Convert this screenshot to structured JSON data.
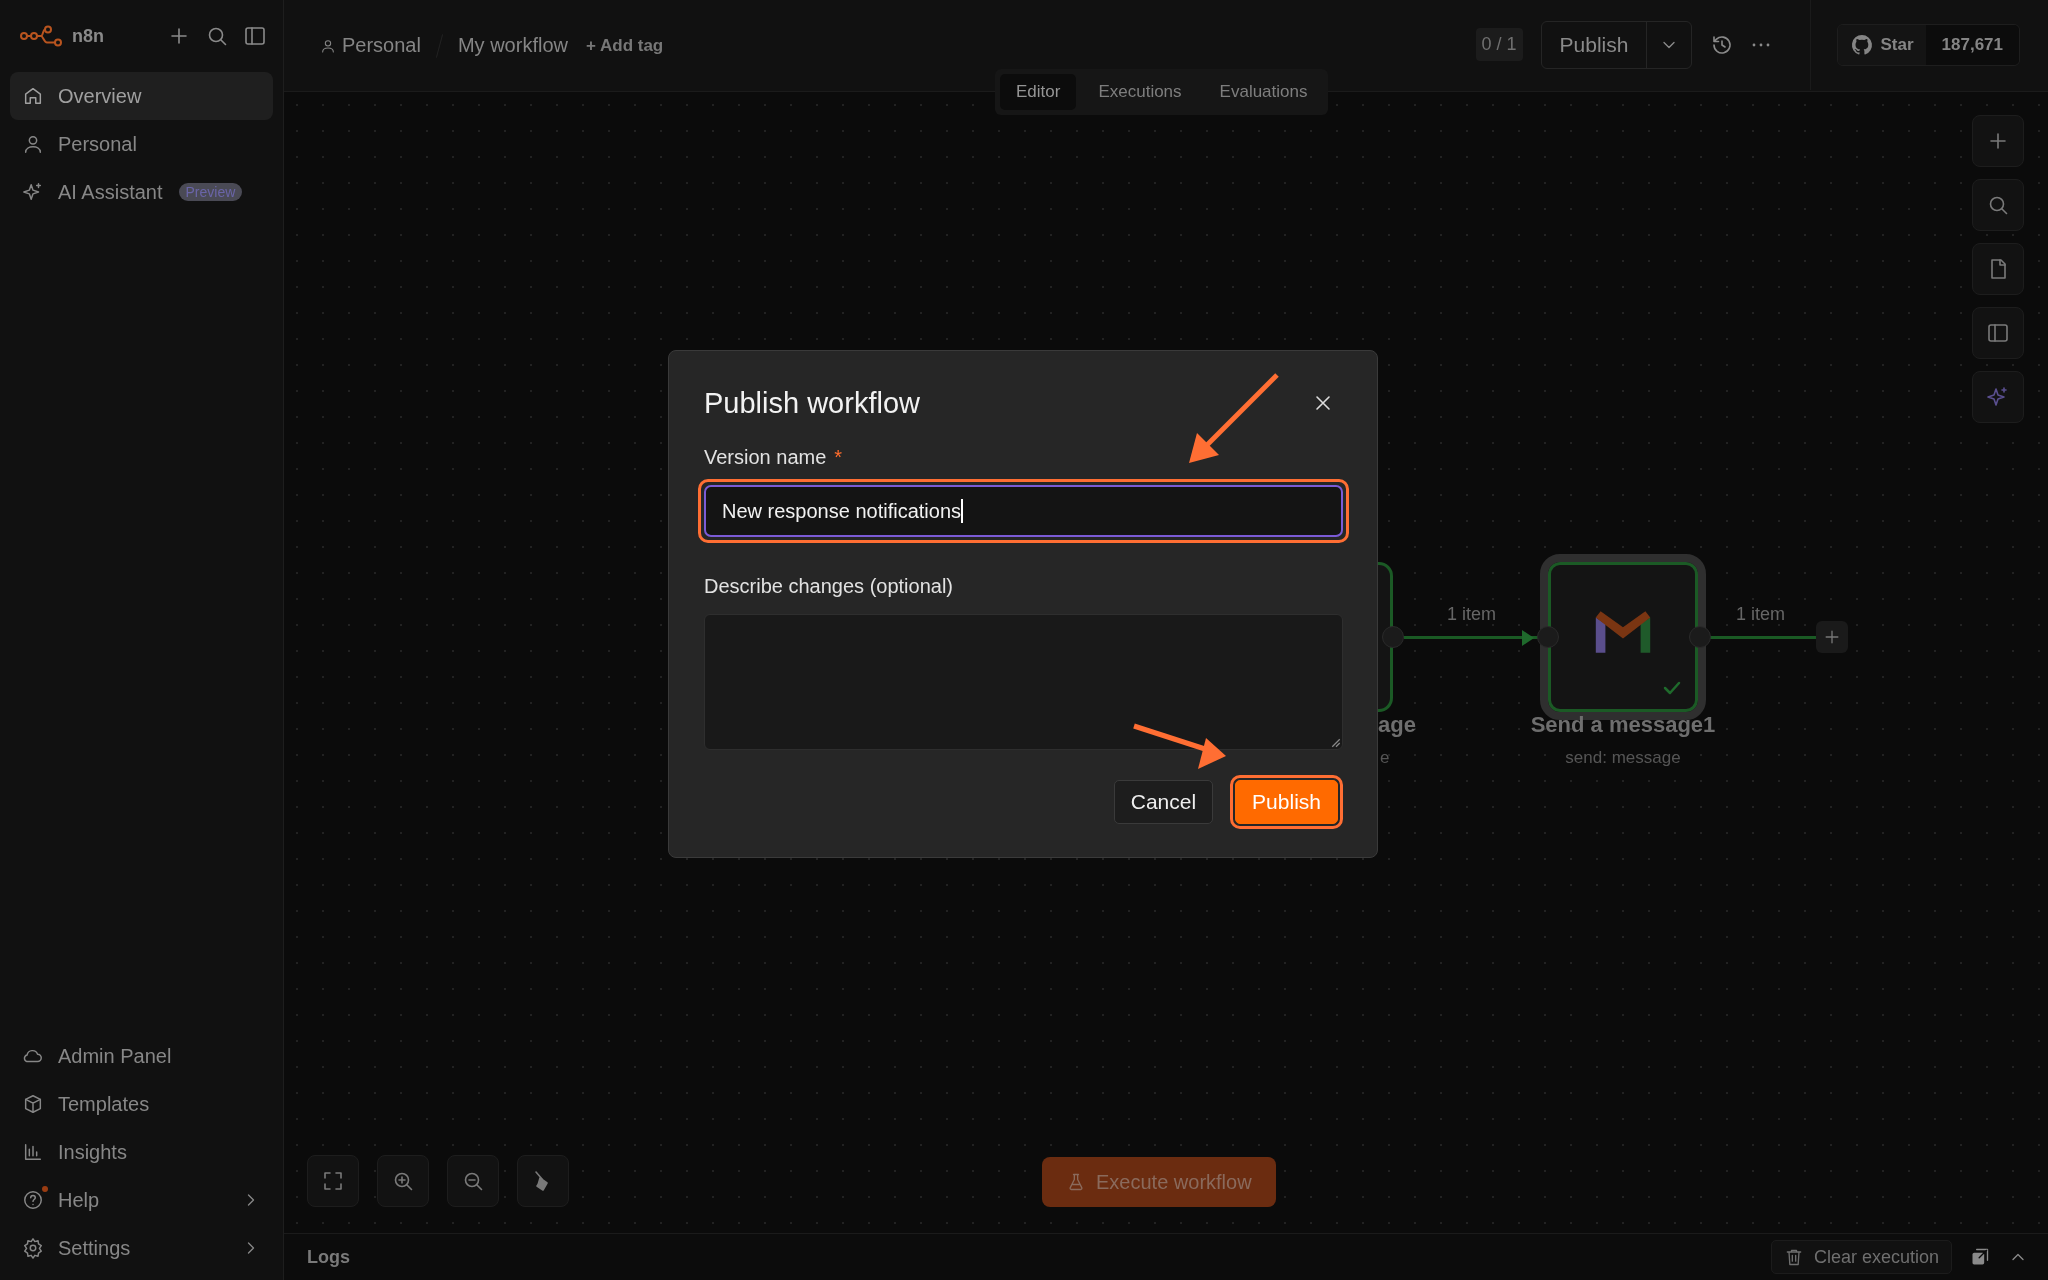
{
  "sidebar": {
    "brand": "n8n",
    "items": [
      {
        "label": "Overview",
        "selected": true
      },
      {
        "label": "Personal",
        "selected": false
      },
      {
        "label": "AI Assistant",
        "selected": false,
        "badge": "Preview"
      }
    ],
    "bottom_items": [
      {
        "label": "Admin Panel",
        "submenu": false,
        "notification": false
      },
      {
        "label": "Templates",
        "submenu": false,
        "notification": false
      },
      {
        "label": "Insights",
        "submenu": false,
        "notification": false
      },
      {
        "label": "Help",
        "submenu": true,
        "notification": true
      },
      {
        "label": "Settings",
        "submenu": true,
        "notification": false
      }
    ]
  },
  "topbar": {
    "breadcrumb": [
      "Personal",
      "My workflow"
    ],
    "add_tag": "+ Add tag",
    "version_count": "0 / 1",
    "publish": "Publish",
    "github": {
      "label": "Star",
      "count": "187,671"
    }
  },
  "tabs": [
    {
      "label": "Editor",
      "selected": true
    },
    {
      "label": "Executions",
      "selected": false
    },
    {
      "label": "Evaluations",
      "selected": false
    }
  ],
  "canvas": {
    "nodes": [
      {
        "title": "age",
        "subtitle": "e",
        "success": true
      },
      {
        "title": "Send a message1",
        "subtitle": "send: message",
        "success": true
      }
    ],
    "connections": [
      {
        "label": "1 item"
      },
      {
        "label": "1 item"
      }
    ],
    "execute_button": "Execute workflow"
  },
  "logs": {
    "title": "Logs",
    "clear_button": "Clear execution"
  },
  "dialog": {
    "title": "Publish workflow",
    "fields": [
      {
        "kind": "input",
        "label": "Version name",
        "required_mark": "*",
        "value": "New response notifications",
        "focused": true,
        "highlighted": true
      },
      {
        "kind": "textarea",
        "label": "Describe changes (optional)",
        "focused": false,
        "highlighted": false
      }
    ],
    "buttons": [
      {
        "label": "Cancel",
        "primary": false,
        "highlighted": false
      },
      {
        "label": "Publish",
        "primary": true,
        "highlighted": true
      }
    ]
  }
}
